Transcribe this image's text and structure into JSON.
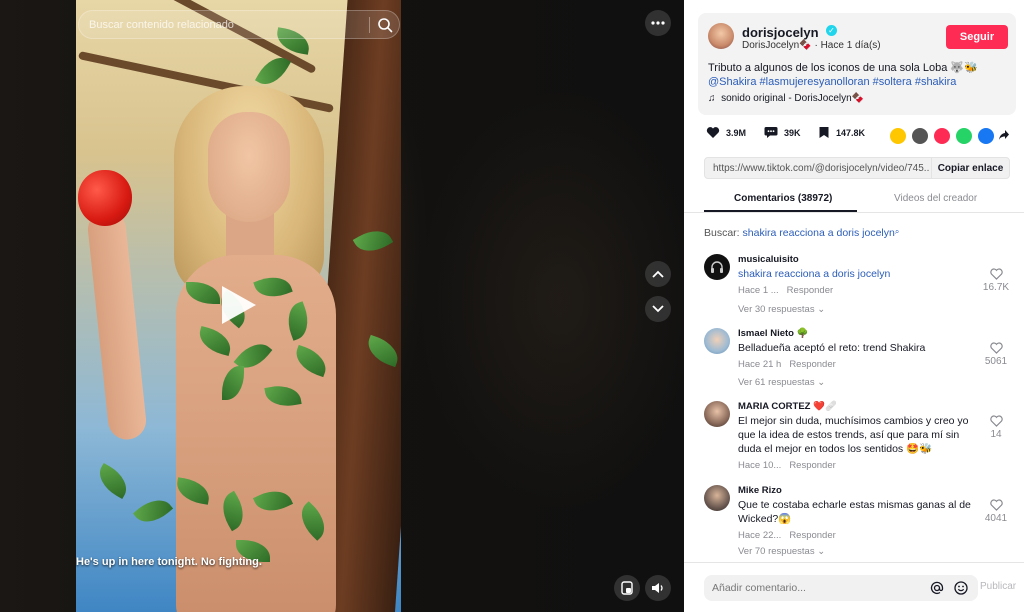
{
  "video": {
    "search_placeholder": "Buscar contenido relacionado",
    "caption": "He's up in here tonight. No fighting."
  },
  "post": {
    "author": "dorisjocelyn",
    "author_sub": "DorisJocelyn🍫 · Hace 1 día(s)",
    "follow_label": "Seguir",
    "description": "Tributo a algunos de los iconos de una sola Loba 🐺🐝",
    "hashtags": "@Shakira #lasmujeresyanolloran #soltera #shakira",
    "music": "sonido original - DorisJocelyn🍫"
  },
  "stats": {
    "likes": "3.9M",
    "comments": "39K",
    "saves": "147.8K"
  },
  "share": {
    "link": "https://www.tiktok.com/@dorisjocelyn/video/745...",
    "copy_label": "Copiar enlace"
  },
  "tabs": {
    "comments": "Comentarios (38972)",
    "creator_videos": "Videos del creador"
  },
  "search_hint": {
    "prefix": "Buscar:",
    "query": "shakira reacciona a doris jocelyn"
  },
  "comments": [
    {
      "name": "musicaluisito",
      "text": "shakira reacciona a doris jocelyn",
      "time": "Hace 1 ...",
      "reply": "Responder",
      "replies": "Ver 30 respuestas",
      "likes": "16.7K"
    },
    {
      "name": "Ismael Nieto 🌳",
      "text": "Belladueña aceptó el reto: trend Shakira",
      "time": "Hace 21 h",
      "reply": "Responder",
      "replies": "Ver 61 respuestas",
      "likes": "5061"
    },
    {
      "name": "MARIA CORTEZ ❤️🩹",
      "text": "El mejor sin duda, muchísimos cambios y creo yo que la idea de estos trends, así que para mí sin duda el mejor en todos los sentidos 🤩🐝",
      "time": "Hace 10...",
      "reply": "Responder",
      "replies": "",
      "likes": "14"
    },
    {
      "name": "Mike Rizo",
      "text": "Que te costaba echarle estas mismas ganas al de Wicked?😱",
      "time": "Hace 22...",
      "reply": "Responder",
      "replies": "Ver 70 respuestas",
      "likes": "4041"
    }
  ],
  "comment_box": {
    "placeholder": "Añadir comentario...",
    "post_label": "Publicar"
  },
  "colors": {
    "accent": "#fe2c55",
    "link": "#2b5db9"
  }
}
